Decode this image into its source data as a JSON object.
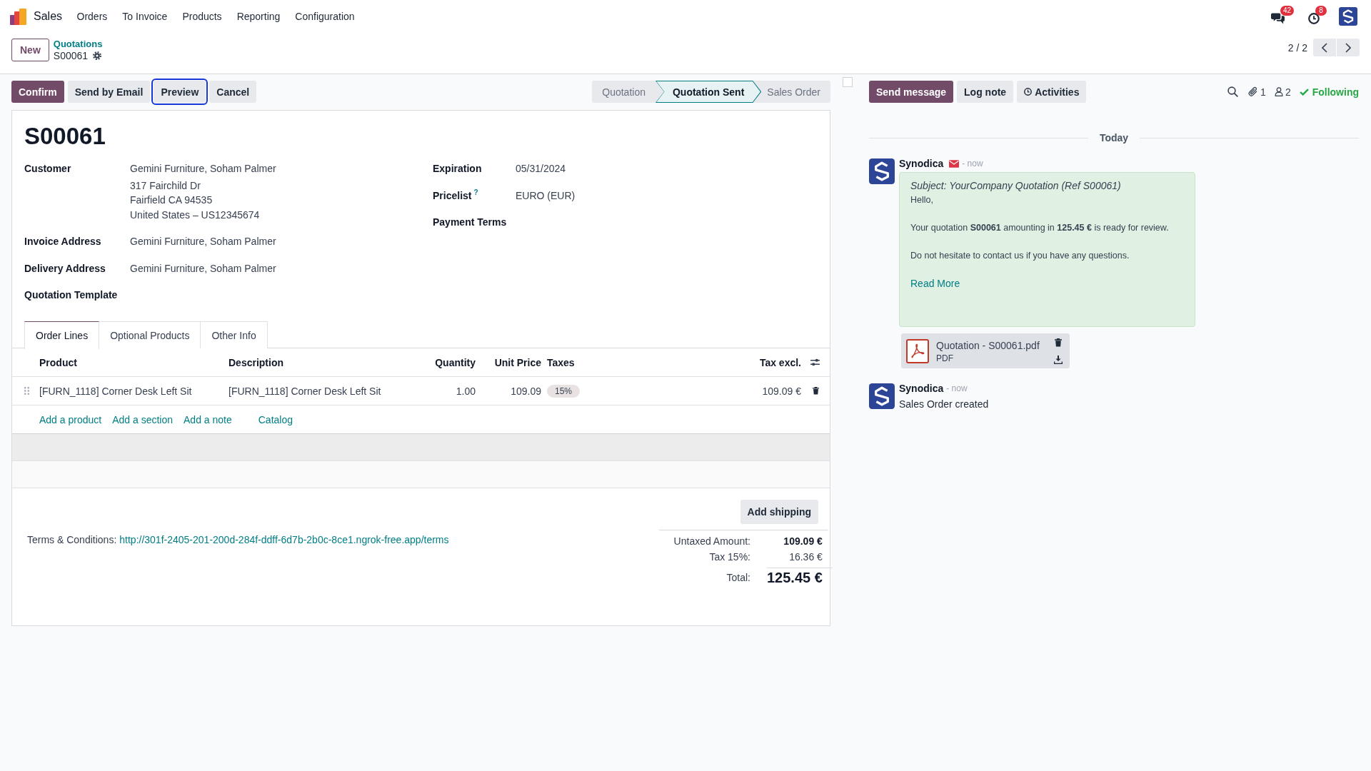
{
  "navbar": {
    "app": "Sales",
    "menu": [
      "Orders",
      "To Invoice",
      "Products",
      "Reporting",
      "Configuration"
    ],
    "messages_badge": "42",
    "activities_badge": "8"
  },
  "control_panel": {
    "new_button": "New",
    "breadcrumb": "Quotations",
    "record": "S00061",
    "pager": "2 / 2"
  },
  "actions": [
    {
      "label": "Confirm",
      "kind": "primary",
      "focused": false
    },
    {
      "label": "Send by Email",
      "kind": "secondary",
      "focused": false
    },
    {
      "label": "Preview",
      "kind": "secondary",
      "focused": true
    },
    {
      "label": "Cancel",
      "kind": "secondary",
      "focused": false
    }
  ],
  "statusbar": [
    {
      "label": "Quotation",
      "selected": false
    },
    {
      "label": "Quotation Sent",
      "selected": true
    },
    {
      "label": "Sales Order",
      "selected": false
    }
  ],
  "checkbox": {
    "checked": false
  },
  "form": {
    "title": "S00061",
    "left_fields": [
      {
        "label": "Customer",
        "lines": [
          "Gemini Furniture, Soham Palmer",
          "317 Fairchild Dr",
          "Fairfield CA 94535",
          "United States – US12345674"
        ]
      },
      {
        "label": "Invoice Address",
        "lines": [
          "Gemini Furniture, Soham Palmer"
        ]
      },
      {
        "label": "Delivery Address",
        "lines": [
          "Gemini Furniture, Soham Palmer"
        ]
      },
      {
        "label": "Quotation Template"
      }
    ],
    "right_fields": [
      {
        "label": "Expiration",
        "lines": [
          "05/31/2024"
        ]
      },
      {
        "label": "Pricelist",
        "help": "?",
        "lines": [
          "EURO (EUR)"
        ]
      },
      {
        "label": "Payment Terms"
      }
    ]
  },
  "tabs": [
    {
      "label": "Order Lines",
      "selected": true
    },
    {
      "label": "Optional Products",
      "selected": false
    },
    {
      "label": "Other Info",
      "selected": false
    }
  ],
  "order_lines": {
    "columns": [
      "Product",
      "Description",
      "Quantity",
      "Unit Price",
      "Taxes",
      "Tax excl."
    ],
    "rows": [
      {
        "product": "[FURN_1118] Corner Desk Left Sit",
        "description": "[FURN_1118] Corner Desk Left Sit",
        "quantity": "1.00",
        "unit_price": "109.09",
        "taxes": [
          "15%"
        ],
        "tax_excl": "109.09 €"
      }
    ],
    "add_links": [
      "Add a product",
      "Add a section",
      "Add a note",
      "Catalog"
    ]
  },
  "add_shipping": "Add shipping",
  "terms": {
    "label": "Terms & Conditions:",
    "link": "http://301f-2405-201-200d-284f-ddff-6d7b-2b0c-8ce1.ngrok-free.app/terms"
  },
  "totals": [
    {
      "label": "Untaxed Amount:",
      "value": "109.09 €",
      "kind": "subtotal"
    },
    {
      "label": "Tax 15%:",
      "value": "16.36 €",
      "kind": "tax"
    },
    {
      "label": "Total:",
      "value": "125.45 €",
      "kind": "total"
    }
  ],
  "chatter": {
    "buttons": [
      {
        "label": "Send message",
        "kind": "primary"
      },
      {
        "label": "Log note",
        "kind": "secondary"
      },
      {
        "label": "Activities",
        "kind": "activities"
      }
    ],
    "attachments_count": "1",
    "followers_count": "2",
    "follow_label": "Following",
    "date_separator": "Today",
    "messages": [
      {
        "kind": "email",
        "author": "Synodica",
        "time": "- now",
        "subject": "Subject: YourCompany Quotation (Ref S00061)",
        "paragraphs": [
          "Hello,",
          "Your quotation **S00061** amounting in **125.45 €** is ready for review.",
          "Do not hesitate to contact us if you have any questions."
        ],
        "read_more": "Read More",
        "attachments": [
          {
            "name": "Quotation - S00061.pdf",
            "type": "PDF"
          }
        ]
      },
      {
        "kind": "note",
        "author": "Synodica",
        "time": "- now",
        "body": "Sales Order created"
      }
    ]
  }
}
